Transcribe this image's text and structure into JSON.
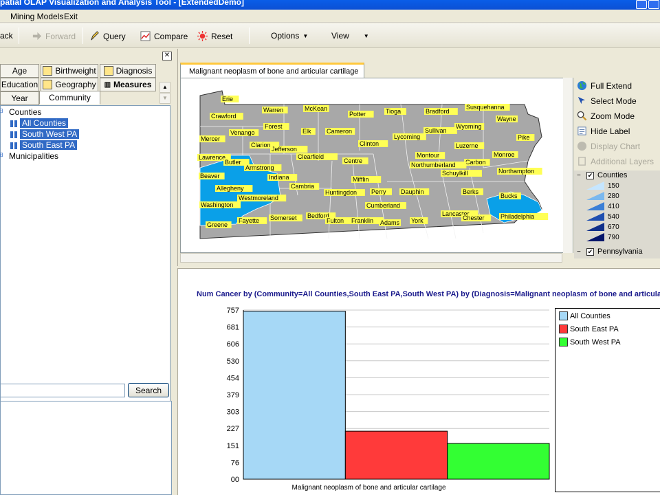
{
  "window": {
    "title": "patial OLAP Visualization and Analysis Tool - [ExtendedDemo]"
  },
  "menu": {
    "items": [
      "Mining Models",
      "Exit"
    ]
  },
  "toolbar": {
    "back_label": "ack",
    "forward_label": "Forward",
    "query_label": "Query",
    "compare_label": "Compare",
    "reset_label": "Reset",
    "options_label": "Options",
    "view_label": "View"
  },
  "left": {
    "tabs_row1": [
      "Age",
      "Birthweight",
      "Diagnosis"
    ],
    "tabs_row2": [
      "Education",
      "Geography",
      "Measures"
    ],
    "tabs_row3": [
      "Year",
      "Community"
    ],
    "tree": {
      "root": "Counties",
      "children": [
        "All Counties",
        "South West PA",
        "South East PA"
      ],
      "root2": "Municipalities"
    },
    "search_value": "",
    "search_button": "Search"
  },
  "map": {
    "tab_label": "Malignant neoplasm of bone and articular cartilage",
    "controls": {
      "full_extend": "Full Extend",
      "select_mode": "Select Mode",
      "zoom_mode": "Zoom Mode",
      "hide_label": "Hide Label",
      "display_chart": "Display Chart",
      "additional_layers": "Additional Layers"
    },
    "layers": {
      "counties": "Counties",
      "legend_values": [
        "150",
        "280",
        "410",
        "540",
        "670",
        "790"
      ],
      "legend_colors": [
        "#c6e6ff",
        "#7bb8ee",
        "#3b7fd6",
        "#1f4fb0",
        "#10308a",
        "#06166a"
      ],
      "pennsylvania": "Pennsylvania"
    },
    "highlight_color": "#0aa0e8",
    "base_color": "#a8a8a8",
    "county_labels": [
      {
        "name": "Erie"
      },
      {
        "name": "Warren"
      },
      {
        "name": "McKean"
      },
      {
        "name": "Potter"
      },
      {
        "name": "Tioga"
      },
      {
        "name": "Bradford"
      },
      {
        "name": "Susquehanna"
      },
      {
        "name": "Crawford"
      },
      {
        "name": "Wayne"
      },
      {
        "name": "Forest"
      },
      {
        "name": "Venango"
      },
      {
        "name": "Elk"
      },
      {
        "name": "Cameron"
      },
      {
        "name": "Sullivan"
      },
      {
        "name": "Wyoming"
      },
      {
        "name": "Mercer"
      },
      {
        "name": "Lycoming"
      },
      {
        "name": "Pike"
      },
      {
        "name": "Clarion"
      },
      {
        "name": "Jefferson"
      },
      {
        "name": "Clinton"
      },
      {
        "name": "Luzerne"
      },
      {
        "name": "Lawrence"
      },
      {
        "name": "Clearfield"
      },
      {
        "name": "Monroe"
      },
      {
        "name": "Butler"
      },
      {
        "name": "Montour"
      },
      {
        "name": "Centre"
      },
      {
        "name": "Carbon"
      },
      {
        "name": "Armstrong"
      },
      {
        "name": "Northumberland"
      },
      {
        "name": "Beaver"
      },
      {
        "name": "Indiana"
      },
      {
        "name": "Northampton"
      },
      {
        "name": "Schuylkill"
      },
      {
        "name": "Mifflin"
      },
      {
        "name": "Allegheny"
      },
      {
        "name": "Cambria"
      },
      {
        "name": "Huntingdon"
      },
      {
        "name": "Perry"
      },
      {
        "name": "Dauphin"
      },
      {
        "name": "Berks"
      },
      {
        "name": "Westmoreland"
      },
      {
        "name": "Bucks"
      },
      {
        "name": "Washington"
      },
      {
        "name": "Cumberland"
      },
      {
        "name": "Lancaster"
      },
      {
        "name": "Philadelphia"
      },
      {
        "name": "Fayette"
      },
      {
        "name": "Somerset"
      },
      {
        "name": "Bedford"
      },
      {
        "name": "York"
      },
      {
        "name": "Chester"
      },
      {
        "name": "Greene"
      },
      {
        "name": "Fulton"
      },
      {
        "name": "Franklin"
      },
      {
        "name": "Adams"
      }
    ]
  },
  "chart_data": {
    "type": "bar",
    "title": "Num Cancer by (Community=All Counties,South East PA,South West PA) by (Diagnosis=Malignant neoplasm of bone and articular c",
    "categories": [
      "Malignant neoplasm of bone and articular cartilage"
    ],
    "series": [
      {
        "name": "All Counties",
        "values": [
          752
        ],
        "color": "#a6d8f6"
      },
      {
        "name": "South East PA",
        "values": [
          215
        ],
        "color": "#ff3a3a"
      },
      {
        "name": "South West PA",
        "values": [
          160
        ],
        "color": "#33ff33"
      }
    ],
    "yticks": [
      "757",
      "681",
      "606",
      "530",
      "454",
      "379",
      "303",
      "227",
      "151",
      "76",
      "00"
    ],
    "ylim": [
      0,
      757
    ],
    "grid": true,
    "legend": "right"
  }
}
